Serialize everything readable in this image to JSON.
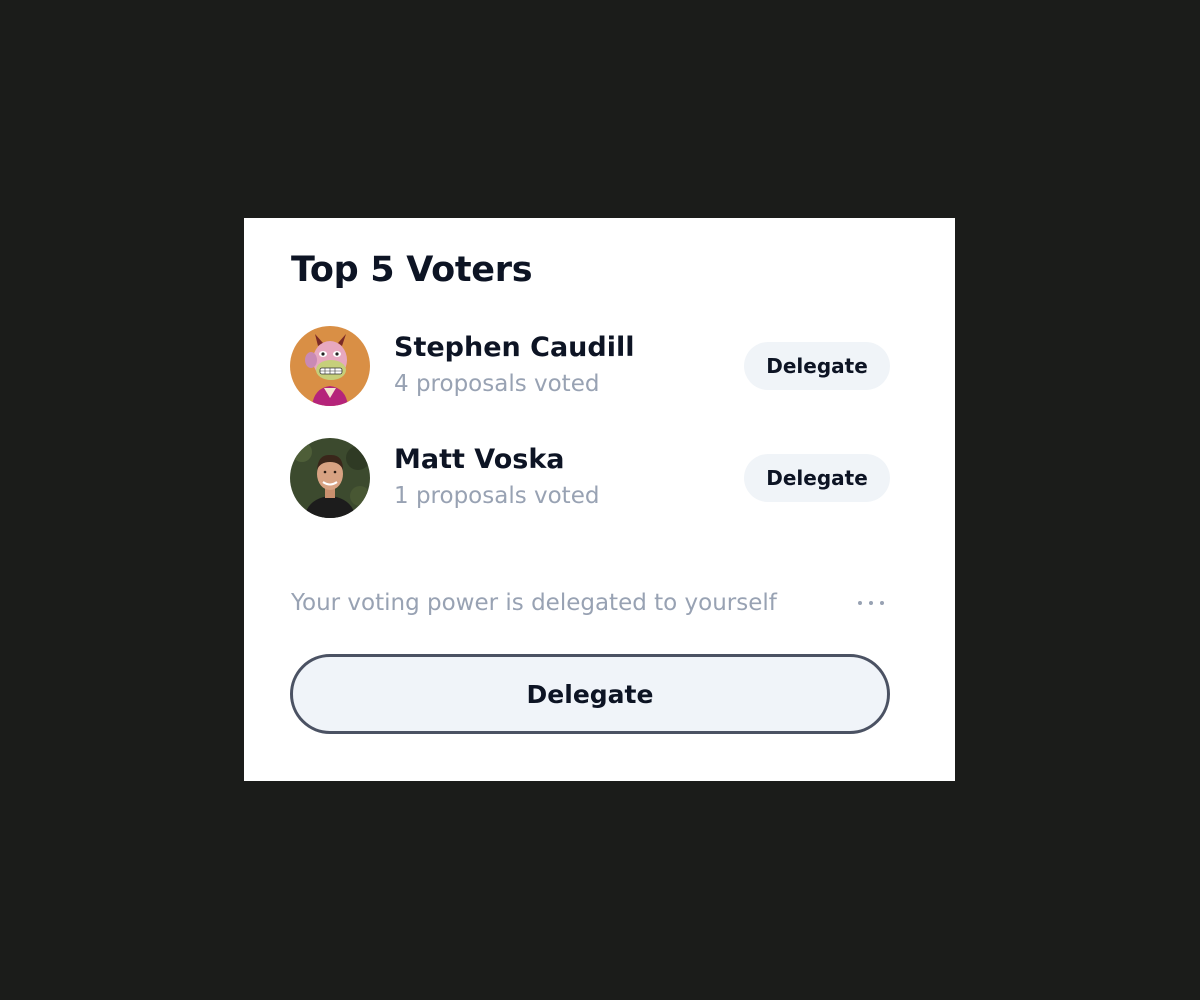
{
  "card": {
    "title": "Top 5 Voters"
  },
  "voters": [
    {
      "name": "Stephen Caudill",
      "votes_text": "4 proposals voted",
      "delegate_label": "Delegate",
      "avatar_icon": "ape-avatar"
    },
    {
      "name": "Matt Voska",
      "votes_text": "1 proposals voted",
      "delegate_label": "Delegate",
      "avatar_icon": "person-photo-avatar"
    }
  ],
  "status": {
    "text": "Your voting power is delegated to yourself",
    "more_icon": "more-horizontal-icon"
  },
  "main_action": {
    "label": "Delegate"
  },
  "colors": {
    "background": "#1b1c1a",
    "card": "#ffffff",
    "text_primary": "#0d1424",
    "text_secondary": "#98a2b3",
    "button_bg": "#f0f4f8",
    "button_border": "#4b5263",
    "avatar_orange": "#d98f45"
  }
}
